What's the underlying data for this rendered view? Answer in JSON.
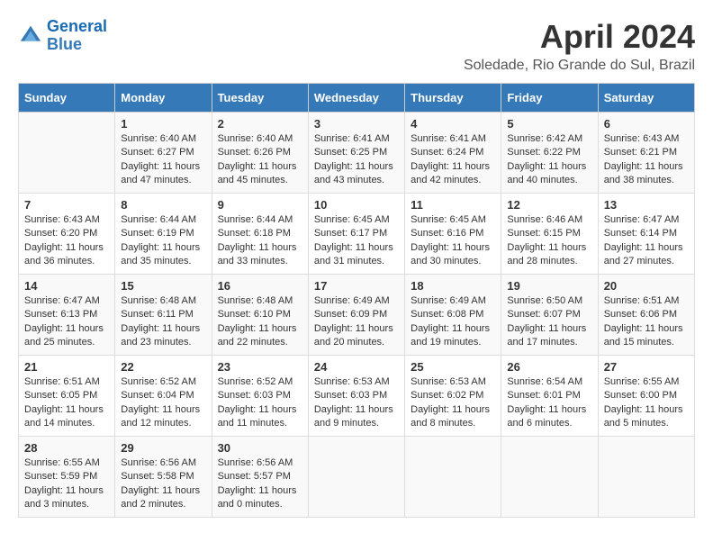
{
  "header": {
    "logo_line1": "General",
    "logo_line2": "Blue",
    "month": "April 2024",
    "location": "Soledade, Rio Grande do Sul, Brazil"
  },
  "weekdays": [
    "Sunday",
    "Monday",
    "Tuesday",
    "Wednesday",
    "Thursday",
    "Friday",
    "Saturday"
  ],
  "weeks": [
    [
      {
        "day": "",
        "sunrise": "",
        "sunset": "",
        "daylight": ""
      },
      {
        "day": "1",
        "sunrise": "Sunrise: 6:40 AM",
        "sunset": "Sunset: 6:27 PM",
        "daylight": "Daylight: 11 hours and 47 minutes."
      },
      {
        "day": "2",
        "sunrise": "Sunrise: 6:40 AM",
        "sunset": "Sunset: 6:26 PM",
        "daylight": "Daylight: 11 hours and 45 minutes."
      },
      {
        "day": "3",
        "sunrise": "Sunrise: 6:41 AM",
        "sunset": "Sunset: 6:25 PM",
        "daylight": "Daylight: 11 hours and 43 minutes."
      },
      {
        "day": "4",
        "sunrise": "Sunrise: 6:41 AM",
        "sunset": "Sunset: 6:24 PM",
        "daylight": "Daylight: 11 hours and 42 minutes."
      },
      {
        "day": "5",
        "sunrise": "Sunrise: 6:42 AM",
        "sunset": "Sunset: 6:22 PM",
        "daylight": "Daylight: 11 hours and 40 minutes."
      },
      {
        "day": "6",
        "sunrise": "Sunrise: 6:43 AM",
        "sunset": "Sunset: 6:21 PM",
        "daylight": "Daylight: 11 hours and 38 minutes."
      }
    ],
    [
      {
        "day": "7",
        "sunrise": "Sunrise: 6:43 AM",
        "sunset": "Sunset: 6:20 PM",
        "daylight": "Daylight: 11 hours and 36 minutes."
      },
      {
        "day": "8",
        "sunrise": "Sunrise: 6:44 AM",
        "sunset": "Sunset: 6:19 PM",
        "daylight": "Daylight: 11 hours and 35 minutes."
      },
      {
        "day": "9",
        "sunrise": "Sunrise: 6:44 AM",
        "sunset": "Sunset: 6:18 PM",
        "daylight": "Daylight: 11 hours and 33 minutes."
      },
      {
        "day": "10",
        "sunrise": "Sunrise: 6:45 AM",
        "sunset": "Sunset: 6:17 PM",
        "daylight": "Daylight: 11 hours and 31 minutes."
      },
      {
        "day": "11",
        "sunrise": "Sunrise: 6:45 AM",
        "sunset": "Sunset: 6:16 PM",
        "daylight": "Daylight: 11 hours and 30 minutes."
      },
      {
        "day": "12",
        "sunrise": "Sunrise: 6:46 AM",
        "sunset": "Sunset: 6:15 PM",
        "daylight": "Daylight: 11 hours and 28 minutes."
      },
      {
        "day": "13",
        "sunrise": "Sunrise: 6:47 AM",
        "sunset": "Sunset: 6:14 PM",
        "daylight": "Daylight: 11 hours and 27 minutes."
      }
    ],
    [
      {
        "day": "14",
        "sunrise": "Sunrise: 6:47 AM",
        "sunset": "Sunset: 6:13 PM",
        "daylight": "Daylight: 11 hours and 25 minutes."
      },
      {
        "day": "15",
        "sunrise": "Sunrise: 6:48 AM",
        "sunset": "Sunset: 6:11 PM",
        "daylight": "Daylight: 11 hours and 23 minutes."
      },
      {
        "day": "16",
        "sunrise": "Sunrise: 6:48 AM",
        "sunset": "Sunset: 6:10 PM",
        "daylight": "Daylight: 11 hours and 22 minutes."
      },
      {
        "day": "17",
        "sunrise": "Sunrise: 6:49 AM",
        "sunset": "Sunset: 6:09 PM",
        "daylight": "Daylight: 11 hours and 20 minutes."
      },
      {
        "day": "18",
        "sunrise": "Sunrise: 6:49 AM",
        "sunset": "Sunset: 6:08 PM",
        "daylight": "Daylight: 11 hours and 19 minutes."
      },
      {
        "day": "19",
        "sunrise": "Sunrise: 6:50 AM",
        "sunset": "Sunset: 6:07 PM",
        "daylight": "Daylight: 11 hours and 17 minutes."
      },
      {
        "day": "20",
        "sunrise": "Sunrise: 6:51 AM",
        "sunset": "Sunset: 6:06 PM",
        "daylight": "Daylight: 11 hours and 15 minutes."
      }
    ],
    [
      {
        "day": "21",
        "sunrise": "Sunrise: 6:51 AM",
        "sunset": "Sunset: 6:05 PM",
        "daylight": "Daylight: 11 hours and 14 minutes."
      },
      {
        "day": "22",
        "sunrise": "Sunrise: 6:52 AM",
        "sunset": "Sunset: 6:04 PM",
        "daylight": "Daylight: 11 hours and 12 minutes."
      },
      {
        "day": "23",
        "sunrise": "Sunrise: 6:52 AM",
        "sunset": "Sunset: 6:03 PM",
        "daylight": "Daylight: 11 hours and 11 minutes."
      },
      {
        "day": "24",
        "sunrise": "Sunrise: 6:53 AM",
        "sunset": "Sunset: 6:03 PM",
        "daylight": "Daylight: 11 hours and 9 minutes."
      },
      {
        "day": "25",
        "sunrise": "Sunrise: 6:53 AM",
        "sunset": "Sunset: 6:02 PM",
        "daylight": "Daylight: 11 hours and 8 minutes."
      },
      {
        "day": "26",
        "sunrise": "Sunrise: 6:54 AM",
        "sunset": "Sunset: 6:01 PM",
        "daylight": "Daylight: 11 hours and 6 minutes."
      },
      {
        "day": "27",
        "sunrise": "Sunrise: 6:55 AM",
        "sunset": "Sunset: 6:00 PM",
        "daylight": "Daylight: 11 hours and 5 minutes."
      }
    ],
    [
      {
        "day": "28",
        "sunrise": "Sunrise: 6:55 AM",
        "sunset": "Sunset: 5:59 PM",
        "daylight": "Daylight: 11 hours and 3 minutes."
      },
      {
        "day": "29",
        "sunrise": "Sunrise: 6:56 AM",
        "sunset": "Sunset: 5:58 PM",
        "daylight": "Daylight: 11 hours and 2 minutes."
      },
      {
        "day": "30",
        "sunrise": "Sunrise: 6:56 AM",
        "sunset": "Sunset: 5:57 PM",
        "daylight": "Daylight: 11 hours and 0 minutes."
      },
      {
        "day": "",
        "sunrise": "",
        "sunset": "",
        "daylight": ""
      },
      {
        "day": "",
        "sunrise": "",
        "sunset": "",
        "daylight": ""
      },
      {
        "day": "",
        "sunrise": "",
        "sunset": "",
        "daylight": ""
      },
      {
        "day": "",
        "sunrise": "",
        "sunset": "",
        "daylight": ""
      }
    ]
  ]
}
